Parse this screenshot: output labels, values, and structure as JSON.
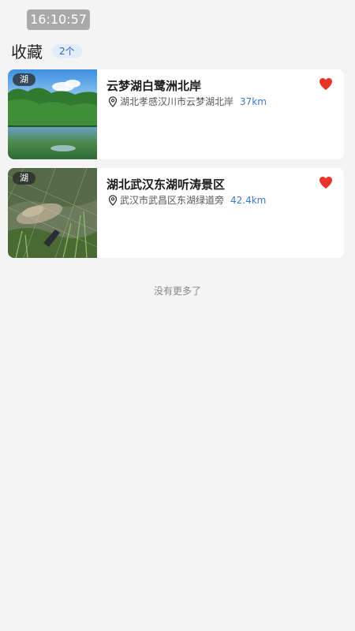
{
  "status_bar": {
    "time": "16:10:57"
  },
  "header": {
    "title": "收藏",
    "count_badge": "2个"
  },
  "favorites": [
    {
      "tag": "湖",
      "title": "云梦湖白鹭洲北岸",
      "address": "湖北孝感汉川市云梦湖北岸",
      "distance": "37km",
      "favorited": true,
      "image": "lake-forest-photo"
    },
    {
      "tag": "湖",
      "title": "湖北武汉东湖听涛景区",
      "address": "武汉市武昌区东湖绿道旁",
      "distance": "42.4km",
      "favorited": true,
      "image": "fish-in-net-photo"
    }
  ],
  "footer": {
    "end_of_list": "没有更多了"
  },
  "icons": {
    "pin": "location-pin-icon",
    "favorite": "heart-icon"
  },
  "colors": {
    "heart": "#e8352b",
    "distance": "#3f7ac2",
    "badge_bg": "#e3ecfb",
    "badge_text": "#2f63c5"
  }
}
